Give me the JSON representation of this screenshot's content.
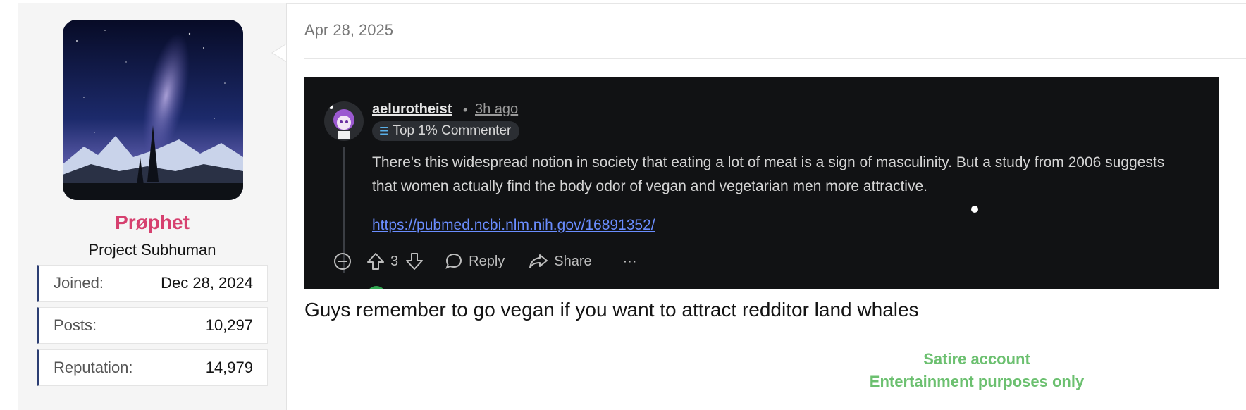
{
  "sidebar": {
    "avatar_alt": "User avatar - night sky over mountains",
    "username": "Prøphet",
    "user_title": "Project Subhuman",
    "stats": [
      {
        "label": "Joined:",
        "value": "Dec 28, 2024"
      },
      {
        "label": "Posts:",
        "value": "10,297"
      },
      {
        "label": "Reputation:",
        "value": "14,979"
      }
    ]
  },
  "post": {
    "date": "Apr 28, 2025",
    "caption": "Guys remember to go vegan if you want to attract redditor land whales"
  },
  "embedded_screenshot": {
    "username": "aelurotheist",
    "separator": "•",
    "time": "3h ago",
    "badge": "Top 1% Commenter",
    "badge_icon": "book-icon",
    "body": "There's this widespread notion in society that eating a lot of meat is a sign of masculinity. But a study from 2006 suggests that women actually find the body odor of vegan and vegetarian men more attractive.",
    "link": "https://pubmed.ncbi.nlm.nih.gov/16891352/",
    "actions": {
      "upvote_count": "3",
      "reply_label": "Reply",
      "share_label": "Share",
      "more_label": "···"
    }
  },
  "signature": {
    "line1": "Satire account",
    "line2": "Entertainment purposes only"
  },
  "colors": {
    "username": "#d6406f",
    "stat_accent": "#2c3e73",
    "signature": "#6cc070",
    "screenshot_bg": "#111214",
    "link": "#6a8dff"
  }
}
